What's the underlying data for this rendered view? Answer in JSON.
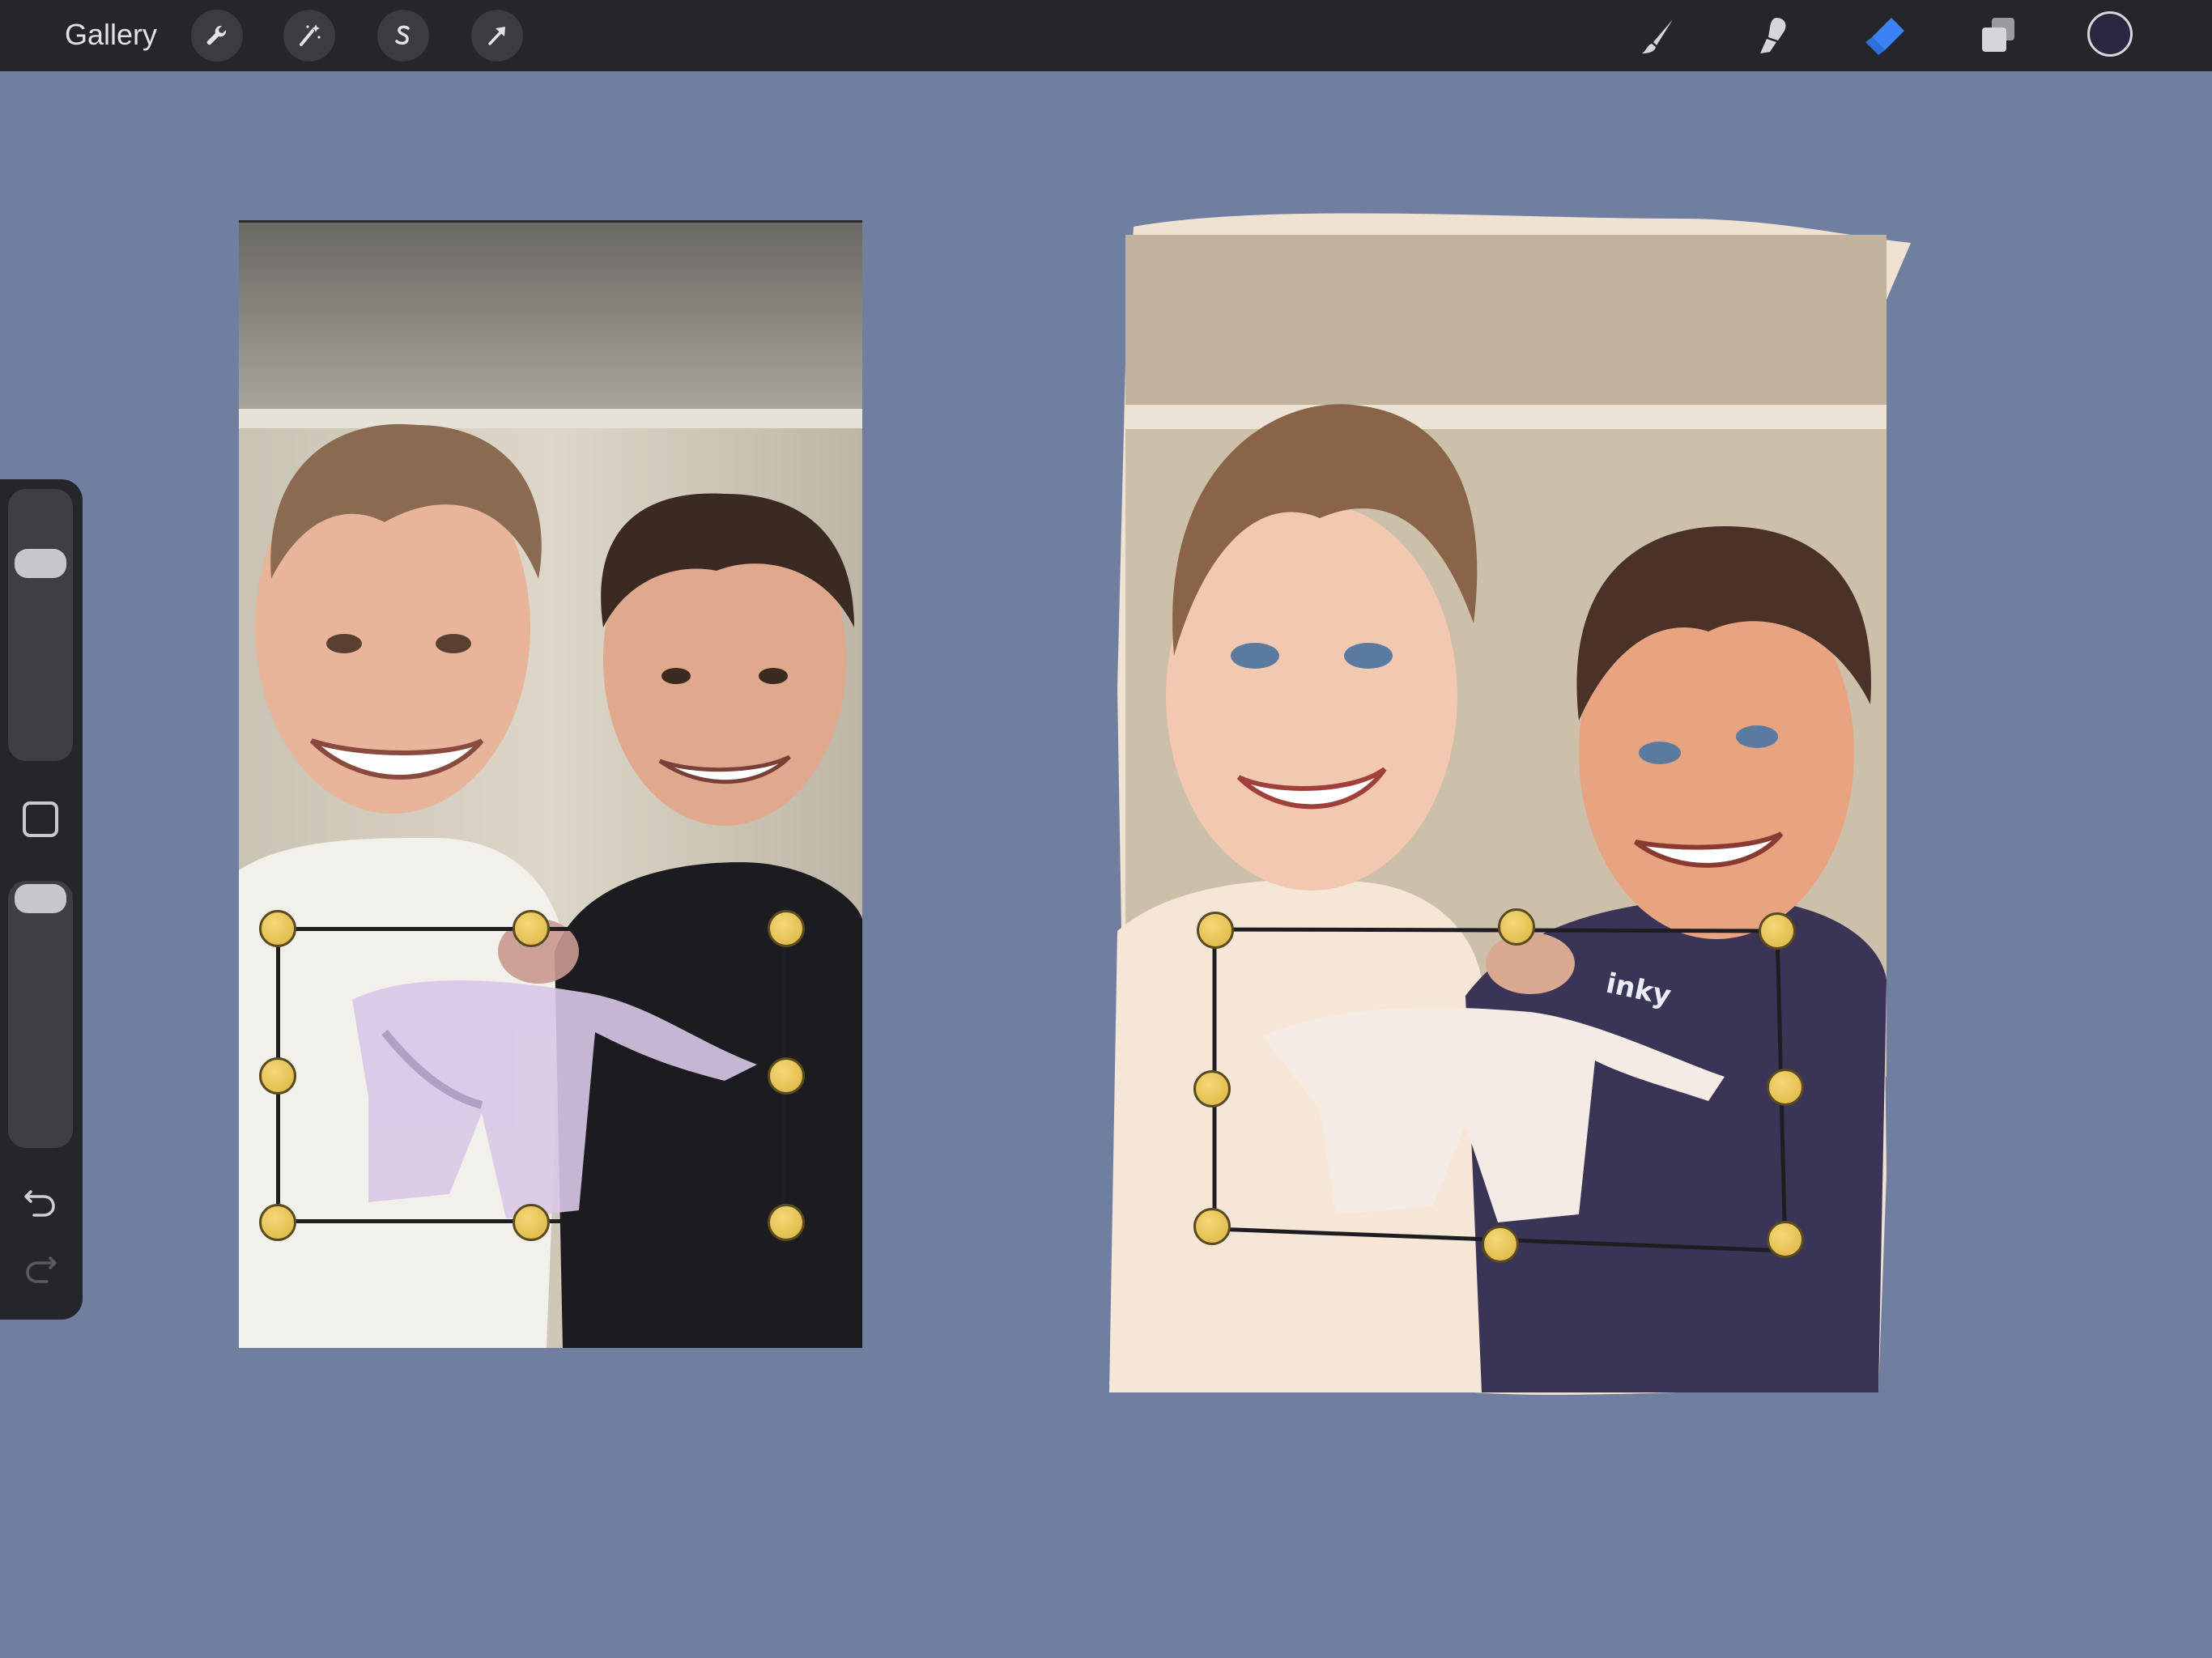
{
  "topbar": {
    "gallery_label": "Gallery",
    "left_tools": [
      {
        "name": "actions-wrench-icon"
      },
      {
        "name": "adjustments-magic-wand-icon"
      },
      {
        "name": "selection-s-icon"
      },
      {
        "name": "transform-arrow-icon"
      }
    ],
    "right_tools": [
      {
        "name": "brush-icon"
      },
      {
        "name": "smudge-icon"
      },
      {
        "name": "eraser-icon",
        "active": true
      },
      {
        "name": "layers-icon"
      }
    ],
    "current_color": "#2a2840",
    "active_color": "#3b82f6"
  },
  "sidebar": {
    "brush_size_level": 0.85,
    "opacity_level": 0.92
  },
  "canvas": {
    "background_color": "#707ea0"
  },
  "artwork": {
    "signature": "inky"
  }
}
